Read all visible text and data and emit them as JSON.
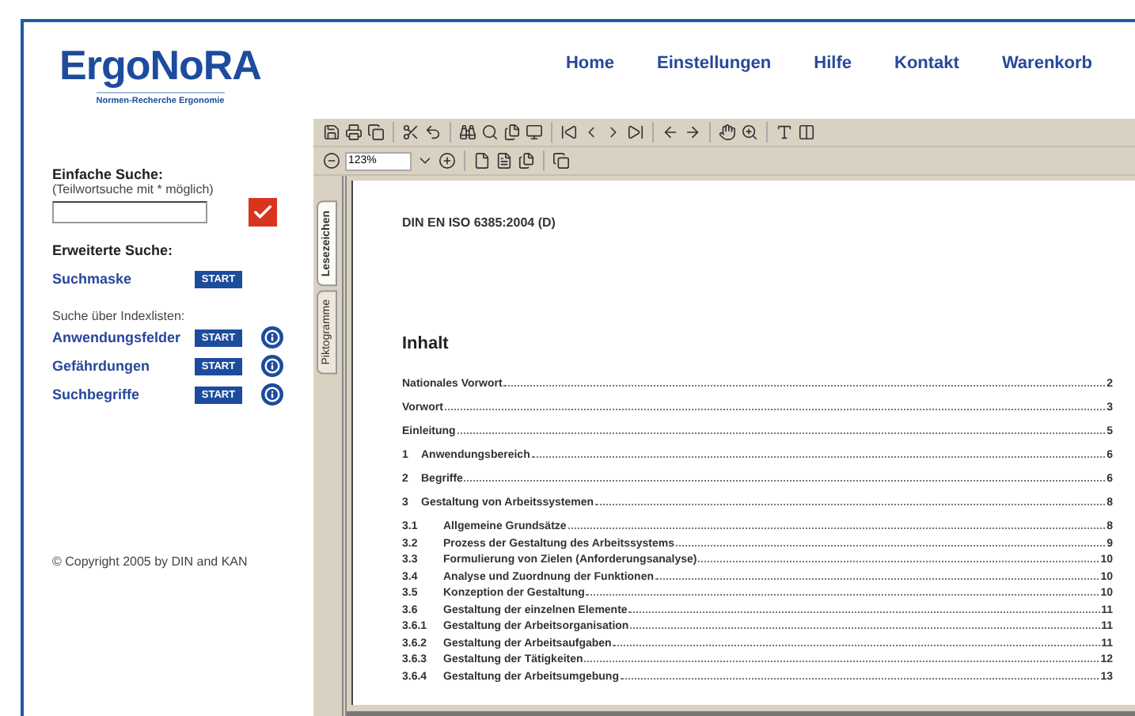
{
  "logo": {
    "title": "ErgoNoRA",
    "subtitle": "Normen-Recherche Ergonomie"
  },
  "nav": [
    "Home",
    "Einstellungen",
    "Hilfe",
    "Kontakt",
    "Warenkorb"
  ],
  "sidebar": {
    "simple_search": {
      "title": "Einfache Suche:",
      "hint": "(Teilwortsuche mit * möglich)",
      "checked": true
    },
    "advanced_title": "Erweiterte Suche:",
    "advanced": [
      {
        "label": "Suchmaske",
        "button": "START",
        "info": false
      }
    ],
    "index_title": "Suche über Indexlisten:",
    "index": [
      {
        "label": "Anwendungsfelder",
        "button": "START",
        "info": true
      },
      {
        "label": "Gefährdungen",
        "button": "START",
        "info": true
      },
      {
        "label": "Suchbegriffe",
        "button": "START",
        "info": true
      }
    ],
    "copyright": "© Copyright 2005 by DIN and KAN"
  },
  "viewer": {
    "zoom": "123%",
    "side_tabs": [
      {
        "label": "Lesezeichen",
        "selected": true
      },
      {
        "label": "Piktogramme",
        "selected": false
      }
    ],
    "document": {
      "header": "DIN EN ISO 6385:2004 (D)",
      "heading": "Inhalt",
      "toc": [
        {
          "kind": "chapter",
          "title": "Nationales Vorwort",
          "page": "2"
        },
        {
          "kind": "chapter",
          "title": "Vorwort",
          "page": "3"
        },
        {
          "kind": "chapter",
          "title": "Einleitung",
          "page": "5"
        },
        {
          "kind": "chapter",
          "number": "1",
          "title": "Anwendungsbereich",
          "page": "6"
        },
        {
          "kind": "chapter",
          "number": "2",
          "title": "Begriffe",
          "page": "6"
        },
        {
          "kind": "chapter",
          "number": "3",
          "title": "Gestaltung von Arbeitssystemen",
          "page": "8"
        },
        {
          "kind": "section",
          "number": "3.1",
          "title": "Allgemeine Grundsätze",
          "page": "8"
        },
        {
          "kind": "section",
          "number": "3.2",
          "title": "Prozess der Gestaltung des Arbeitssystems",
          "page": "9"
        },
        {
          "kind": "section",
          "number": "3.3",
          "title": "Formulierung von Zielen (Anforderungsanalyse)",
          "page": "10"
        },
        {
          "kind": "section",
          "number": "3.4",
          "title": "Analyse und Zuordnung der Funktionen",
          "page": "10"
        },
        {
          "kind": "section",
          "number": "3.5",
          "title": "Konzeption der Gestaltung",
          "page": "10"
        },
        {
          "kind": "section",
          "number": "3.6",
          "title": "Gestaltung der einzelnen Elemente",
          "page": "11"
        },
        {
          "kind": "section",
          "number": "3.6.1",
          "title": "Gestaltung der Arbeitsorganisation",
          "page": "11"
        },
        {
          "kind": "section",
          "number": "3.6.2",
          "title": "Gestaltung der Arbeitsaufgaben",
          "page": "11"
        },
        {
          "kind": "section",
          "number": "3.6.3",
          "title": "Gestaltung der Tätigkeiten",
          "page": "12"
        },
        {
          "kind": "section",
          "number": "3.6.4",
          "title": "Gestaltung der Arbeitsumgebung",
          "page": "13"
        }
      ]
    }
  }
}
